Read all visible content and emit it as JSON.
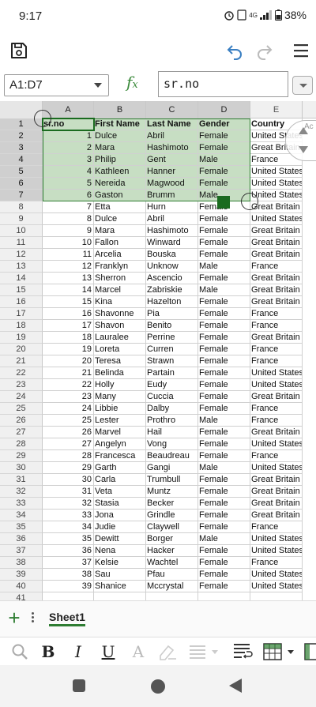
{
  "status": {
    "time": "9:17",
    "battery": "38%",
    "signal": "4G"
  },
  "toolbar": {
    "save_icon": "save-icon",
    "undo_icon": "undo-icon",
    "redo_icon": "redo-icon",
    "menu_icon": "hamburger-menu-icon"
  },
  "formula": {
    "name_box": "A1:D7",
    "fx": "f",
    "fx_sub": "x",
    "content": "sr.no"
  },
  "columns": [
    "A",
    "B",
    "C",
    "D",
    "E"
  ],
  "header_row": [
    "sr.no",
    "First Name",
    "Last Name",
    "Gender",
    "Country"
  ],
  "scroll_hint": "Ac",
  "rows": [
    [
      "1",
      "Dulce",
      "Abril",
      "Female",
      "United States"
    ],
    [
      "2",
      "Mara",
      "Hashimoto",
      "Female",
      "Great Britain"
    ],
    [
      "3",
      "Philip",
      "Gent",
      "Male",
      "France"
    ],
    [
      "4",
      "Kathleen",
      "Hanner",
      "Female",
      "United States"
    ],
    [
      "5",
      "Nereida",
      "Magwood",
      "Female",
      "United States"
    ],
    [
      "6",
      "Gaston",
      "Brumm",
      "Male",
      "United States"
    ],
    [
      "7",
      "Etta",
      "Hurn",
      "Female",
      "Great Britain"
    ],
    [
      "8",
      "Dulce",
      "Abril",
      "Female",
      "United States"
    ],
    [
      "9",
      "Mara",
      "Hashimoto",
      "Female",
      "Great Britain"
    ],
    [
      "10",
      "Fallon",
      "Winward",
      "Female",
      "Great Britain"
    ],
    [
      "11",
      "Arcelia",
      "Bouska",
      "Female",
      "Great Britain"
    ],
    [
      "12",
      "Franklyn",
      "Unknow",
      "Male",
      "France"
    ],
    [
      "13",
      "Sherron",
      "Ascencio",
      "Female",
      "Great Britain"
    ],
    [
      "14",
      "Marcel",
      "Zabriskie",
      "Male",
      "Great Britain"
    ],
    [
      "15",
      "Kina",
      "Hazelton",
      "Female",
      "Great Britain"
    ],
    [
      "16",
      "Shavonne",
      "Pia",
      "Female",
      "France"
    ],
    [
      "17",
      "Shavon",
      "Benito",
      "Female",
      "France"
    ],
    [
      "18",
      "Lauralee",
      "Perrine",
      "Female",
      "Great Britain"
    ],
    [
      "19",
      "Loreta",
      "Curren",
      "Female",
      "France"
    ],
    [
      "20",
      "Teresa",
      "Strawn",
      "Female",
      "France"
    ],
    [
      "21",
      "Belinda",
      "Partain",
      "Female",
      "United States"
    ],
    [
      "22",
      "Holly",
      "Eudy",
      "Female",
      "United States"
    ],
    [
      "23",
      "Many",
      "Cuccia",
      "Female",
      "Great Britain"
    ],
    [
      "24",
      "Libbie",
      "Dalby",
      "Female",
      "France"
    ],
    [
      "25",
      "Lester",
      "Prothro",
      "Male",
      "France"
    ],
    [
      "26",
      "Marvel",
      "Hail",
      "Female",
      "Great Britain"
    ],
    [
      "27",
      "Angelyn",
      "Vong",
      "Female",
      "United States"
    ],
    [
      "28",
      "Francesca",
      "Beaudreau",
      "Female",
      "France"
    ],
    [
      "29",
      "Garth",
      "Gangi",
      "Male",
      "United States"
    ],
    [
      "30",
      "Carla",
      "Trumbull",
      "Female",
      "Great Britain"
    ],
    [
      "31",
      "Veta",
      "Muntz",
      "Female",
      "Great Britain"
    ],
    [
      "32",
      "Stasia",
      "Becker",
      "Female",
      "Great Britain"
    ],
    [
      "33",
      "Jona",
      "Grindle",
      "Female",
      "Great Britain"
    ],
    [
      "34",
      "Judie",
      "Claywell",
      "Female",
      "France"
    ],
    [
      "35",
      "Dewitt",
      "Borger",
      "Male",
      "United States"
    ],
    [
      "36",
      "Nena",
      "Hacker",
      "Female",
      "United States"
    ],
    [
      "37",
      "Kelsie",
      "Wachtel",
      "Female",
      "France"
    ],
    [
      "38",
      "Sau",
      "Pfau",
      "Female",
      "United States"
    ],
    [
      "39",
      "Shanice",
      "Mccrystal",
      "Female",
      "United States"
    ]
  ],
  "row_numbers": [
    "1",
    "2",
    "3",
    "4",
    "5",
    "6",
    "7",
    "8",
    "9",
    "10",
    "11",
    "12",
    "13",
    "14",
    "15",
    "16",
    "17",
    "18",
    "19",
    "20",
    "21",
    "22",
    "23",
    "24",
    "25",
    "26",
    "27",
    "28",
    "29",
    "30",
    "31",
    "32",
    "33",
    "34",
    "35",
    "36",
    "37",
    "38",
    "39",
    "40",
    "41"
  ],
  "sheets": {
    "active": "Sheet1",
    "add": "+"
  },
  "format": {
    "bold": "B",
    "italic": "I",
    "underline": "U",
    "font_color": "A"
  }
}
